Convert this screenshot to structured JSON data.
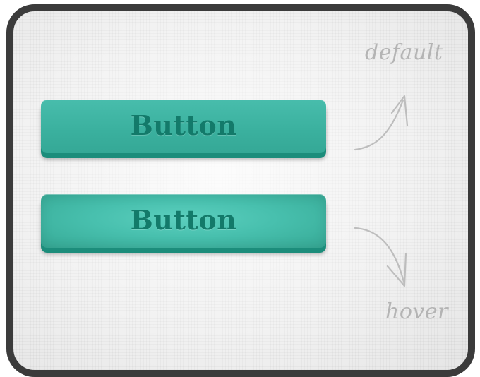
{
  "buttons": {
    "default_label": "Button",
    "hover_label": "Button"
  },
  "annotations": {
    "default": "default",
    "hover": "hover"
  },
  "colors": {
    "frame_border": "#3b3b3b",
    "background": "#eeeeee",
    "button_face": "#3fb3a2",
    "button_face_hover": "#48c0ae",
    "button_edge": "#1c8d7b",
    "button_text": "#137a6a",
    "annotation_text": "#b4b4b4"
  },
  "icons": {
    "default_arrow": "curved-arrow-up-icon",
    "hover_arrow": "curved-arrow-down-icon"
  }
}
